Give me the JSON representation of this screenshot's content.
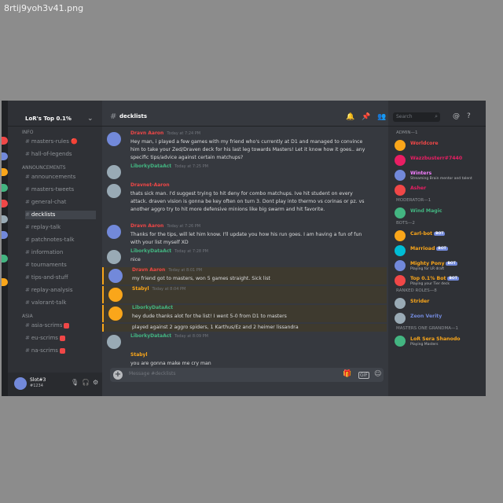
{
  "file_name": "8rtij9yoh3v41.png",
  "server": {
    "name": "LoR's Top 0.1%"
  },
  "channels": [
    {
      "kind": "category",
      "label": "INFO"
    },
    {
      "kind": "channel",
      "label": "masters-rules",
      "suffix": "🔴"
    },
    {
      "kind": "channel",
      "label": "hall-of-legends"
    },
    {
      "kind": "category",
      "label": "ANNOUNCEMENTS"
    },
    {
      "kind": "channel",
      "label": "announcements"
    },
    {
      "kind": "channel",
      "label": "masters-tweets"
    },
    {
      "kind": "channel",
      "label": "general-chat"
    },
    {
      "kind": "channel",
      "label": "decklists",
      "active": true
    },
    {
      "kind": "channel",
      "label": "replay-talk"
    },
    {
      "kind": "channel",
      "label": "patchnotes-talk"
    },
    {
      "kind": "channel",
      "label": "information"
    },
    {
      "kind": "channel",
      "label": "tournaments"
    },
    {
      "kind": "channel",
      "label": "tips-and-stuff"
    },
    {
      "kind": "channel",
      "label": "replay-analysis"
    },
    {
      "kind": "channel",
      "label": "valorant-talk"
    },
    {
      "kind": "category",
      "label": "ASIA"
    },
    {
      "kind": "channel",
      "label": "asia-scrims",
      "badge": true
    },
    {
      "kind": "channel",
      "label": "eu-scrims",
      "badge": true
    },
    {
      "kind": "channel",
      "label": "na-scrims",
      "badge": true
    }
  ],
  "user_panel": {
    "name": "Slot#3",
    "tag": "#1234"
  },
  "channel_header": {
    "title": "decklists"
  },
  "messages": [
    {
      "author": "Dravn Aaron",
      "time": "Today at 7:24 PM",
      "text": "Hey man, i played a few games with my friend who's currently at D1 and managed to convince him to take your Zed/Draven deck for his last leg towards Masters! Let it know how it goes.. any specific tips/advice against certain matchups?",
      "author_color": "#f04747",
      "avatar_color": "#7289da",
      "highlight": false
    },
    {
      "author": "LiborkyDataAct",
      "time": "Today at 7:25 PM",
      "text": "",
      "author_color": "#43b581",
      "avatar_color": "#99aab5",
      "highlight": false
    },
    {
      "author": "Dravnet-Aaron",
      "time": "",
      "text": "thats sick man. I'd suggest trying to hit deny for combo matchups. Ive hit student on every attack. draven vision is gonna be key often on turn 3. Dont play into thermo vs corinas or pz. vs another aggro try to hit more defensive minions like big swarm and hit favorite.",
      "author_color": "#f04747",
      "avatar_color": "#99aab5",
      "highlight": false
    },
    {
      "author": "Dravn Aaron",
      "time": "Today at 7:26 PM",
      "text": "Thanks for the tips, will let him know. I'll update you how his run goes. I am having a fun of fun with your list myself XD",
      "author_color": "#f04747",
      "avatar_color": "#7289da",
      "highlight": false
    },
    {
      "author": "LiborkyDataAct",
      "time": "Today at 7:28 PM",
      "text": "nice",
      "author_color": "#43b581",
      "avatar_color": "#99aab5",
      "highlight": false
    },
    {
      "author": "Dravn Aaron",
      "time": "Today at 8:01 PM",
      "text": "my friend got to masters, won 5 games straight. Sick list",
      "author_color": "#f04747",
      "avatar_color": "#7289da",
      "highlight": true
    },
    {
      "author": "Stabyl",
      "time": "Today at 8:04 PM",
      "text": "",
      "author_color": "#faa61a",
      "avatar_color": "#faa61a",
      "highlight": true
    },
    {
      "author": "LiborkyDataAct",
      "time": "",
      "text": "hey dude thanks alot for the list! I went 5-0 from D1 to masters",
      "author_color": "#43b581",
      "avatar_color": "#faa61a",
      "highlight": true
    },
    {
      "author": "",
      "time": "",
      "text": "played against 2 aggro spiders, 1 Karthus/Ez and 2 heimer lissandra",
      "author_color": "#43b581",
      "avatar_color": "",
      "highlight": true
    },
    {
      "author": "LiborkyDataAct",
      "time": "Today at 8:09 PM",
      "text": "",
      "author_color": "#43b581",
      "avatar_color": "#99aab5",
      "highlight": false
    },
    {
      "author": "Stabyl",
      "time": "",
      "text": "you are gonna make me cry man",
      "author_color": "#faa61a",
      "avatar_color": "",
      "highlight": false
    },
    {
      "author": "",
      "time": "",
      "text": "gggg and welcome to masters",
      "author_color": "#43b581",
      "avatar_color": "",
      "highlight": false
    }
  ],
  "input": {
    "placeholder": "Message #decklists"
  },
  "search": {
    "placeholder": "Search"
  },
  "members": [
    {
      "kind": "role",
      "label": "ADMIN—1"
    },
    {
      "kind": "member",
      "name": "Worldcore",
      "status": "",
      "color": "#f04747",
      "avatar": "#faa61a"
    },
    {
      "kind": "member",
      "name": "Wazzbusterr#7440",
      "status": "",
      "color": "#e91e63",
      "avatar": "#e91e63"
    },
    {
      "kind": "member",
      "name": "Winters",
      "status": "Streaming Brain mentor and talent",
      "color": "#f47fff",
      "avatar": "#7289da"
    },
    {
      "kind": "member",
      "name": "Asher",
      "status": "",
      "color": "#e91e63",
      "avatar": "#f04747"
    },
    {
      "kind": "role",
      "label": "MODERATOR—1"
    },
    {
      "kind": "member",
      "name": "Wind Magic",
      "status": "",
      "color": "#43b581",
      "avatar": "#43b581"
    },
    {
      "kind": "role",
      "label": "BOTS—2"
    },
    {
      "kind": "member",
      "name": "Carl-bot",
      "status": "",
      "color": "#faa61a",
      "avatar": "#faa61a",
      "bot": "BOT"
    },
    {
      "kind": "member",
      "name": "Marrioad",
      "status": "",
      "color": "#faa61a",
      "avatar": "#00bcd4",
      "bot": "BOT"
    },
    {
      "kind": "member",
      "name": "Mighty Pony",
      "status": "Playing for LR draft",
      "color": "#faa61a",
      "avatar": "#7289da",
      "bot": "BOT"
    },
    {
      "kind": "member",
      "name": "Top 0.1% Bot",
      "status": "Playing your Tier deck",
      "color": "#faa61a",
      "avatar": "#f04747",
      "bot": "BOT"
    },
    {
      "kind": "role",
      "label": "RANKED ROLES—8"
    },
    {
      "kind": "member",
      "name": "Strider",
      "status": "",
      "color": "#faa61a",
      "avatar": "#99aab5"
    },
    {
      "kind": "member",
      "name": "Zeon Verity",
      "status": "",
      "color": "#7289da",
      "avatar": "#99aab5"
    },
    {
      "kind": "role",
      "label": "MASTERS ONE GRANDMA—1"
    },
    {
      "kind": "member",
      "name": "LoR Sera Shanodo",
      "status": "Playing Masters",
      "color": "#faa61a",
      "avatar": "#43b581"
    }
  ],
  "icons": {
    "bell": "bell-icon",
    "pin": "pin-icon",
    "people": "members-icon",
    "search": "search-icon",
    "mention": "mention-icon",
    "help": "help-icon",
    "mic": "mic-icon",
    "headphones": "headphones-icon",
    "settings": "gear-icon",
    "gift": "gift-icon",
    "gif": "gif-icon",
    "emoji": "emoji-icon"
  },
  "colors": {
    "accent": "#7289da",
    "bg": "#36393f",
    "sidebar": "#2f3136",
    "highlight": "#faa61a"
  }
}
